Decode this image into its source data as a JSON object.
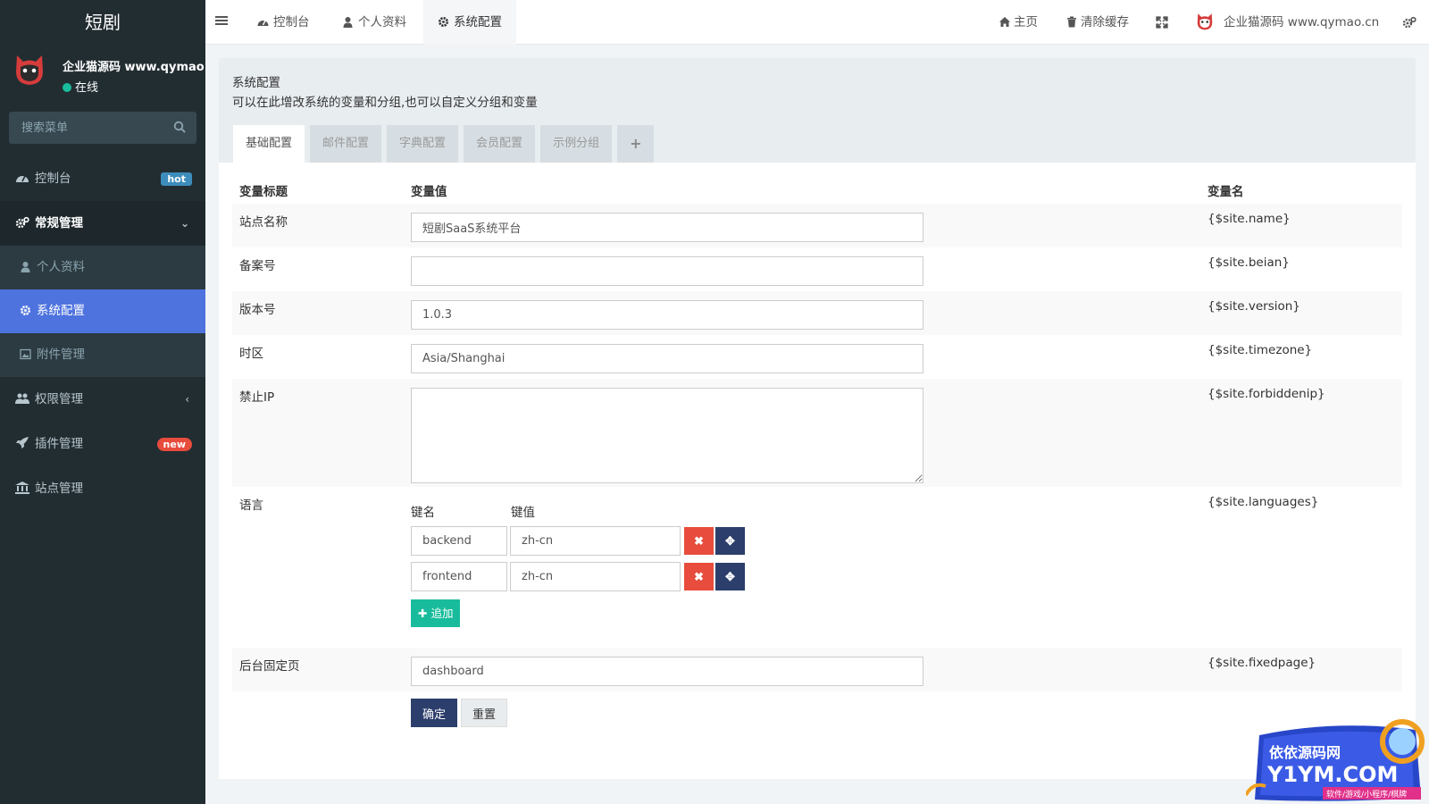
{
  "sidebar": {
    "brand": "短剧",
    "user": {
      "name": "企业猫源码 www.qymao.cn",
      "status": "在线"
    },
    "search_placeholder": "搜索菜单",
    "menu": [
      {
        "label": "控制台",
        "icon": "dashboard-icon",
        "badge": "hot"
      },
      {
        "label": "常规管理",
        "icon": "cogs-icon",
        "open": true
      },
      {
        "label": "权限管理",
        "icon": "users-icon"
      },
      {
        "label": "插件管理",
        "icon": "rocket-icon",
        "badge": "new"
      },
      {
        "label": "站点管理",
        "icon": "bank-icon"
      }
    ],
    "submenu": [
      {
        "label": "个人资料",
        "icon": "user-icon"
      },
      {
        "label": "系统配置",
        "icon": "gear-icon",
        "active": true
      },
      {
        "label": "附件管理",
        "icon": "image-icon"
      }
    ]
  },
  "navbar": {
    "tabs": [
      {
        "label": "控制台",
        "icon": "dashboard-icon"
      },
      {
        "label": "个人资料",
        "icon": "user-icon"
      },
      {
        "label": "系统配置",
        "icon": "gear-icon",
        "active": true
      }
    ],
    "home": "主页",
    "clear_cache": "清除缓存",
    "user_name": "企业猫源码 www.qymao.cn"
  },
  "panel": {
    "title": "系统配置",
    "description": "可以在此增改系统的变量和分组,也可以自定义分组和变量",
    "tabs": [
      "基础配置",
      "邮件配置",
      "字典配置",
      "会员配置",
      "示例分组",
      "+"
    ]
  },
  "table": {
    "headers": {
      "title": "变量标题",
      "value": "变量值",
      "name": "变量名"
    },
    "rows": {
      "site_name": {
        "title": "站点名称",
        "value": "短剧SaaS系统平台",
        "var": "{$site.name}"
      },
      "beian": {
        "title": "备案号",
        "value": "",
        "var": "{$site.beian}"
      },
      "version": {
        "title": "版本号",
        "value": "1.0.3",
        "var": "{$site.version}"
      },
      "timezone": {
        "title": "时区",
        "value": "Asia/Shanghai",
        "var": "{$site.timezone}"
      },
      "forbiddenip": {
        "title": "禁止IP",
        "value": "",
        "var": "{$site.forbiddenip}"
      },
      "languages": {
        "title": "语言",
        "var": "{$site.languages}",
        "key_header": "键名",
        "value_header": "键值",
        "items": [
          {
            "key": "backend",
            "value": "zh-cn"
          },
          {
            "key": "frontend",
            "value": "zh-cn"
          }
        ],
        "add_label": "追加"
      },
      "fixedpage": {
        "title": "后台固定页",
        "value": "dashboard",
        "var": "{$site.fixedpage}"
      }
    },
    "submit_label": "确定",
    "reset_label": "重置"
  },
  "watermark": {
    "line1": "依依源码网",
    "line2": "Y1YM.COM",
    "line3": "软件/游戏/小程序/棋牌"
  }
}
